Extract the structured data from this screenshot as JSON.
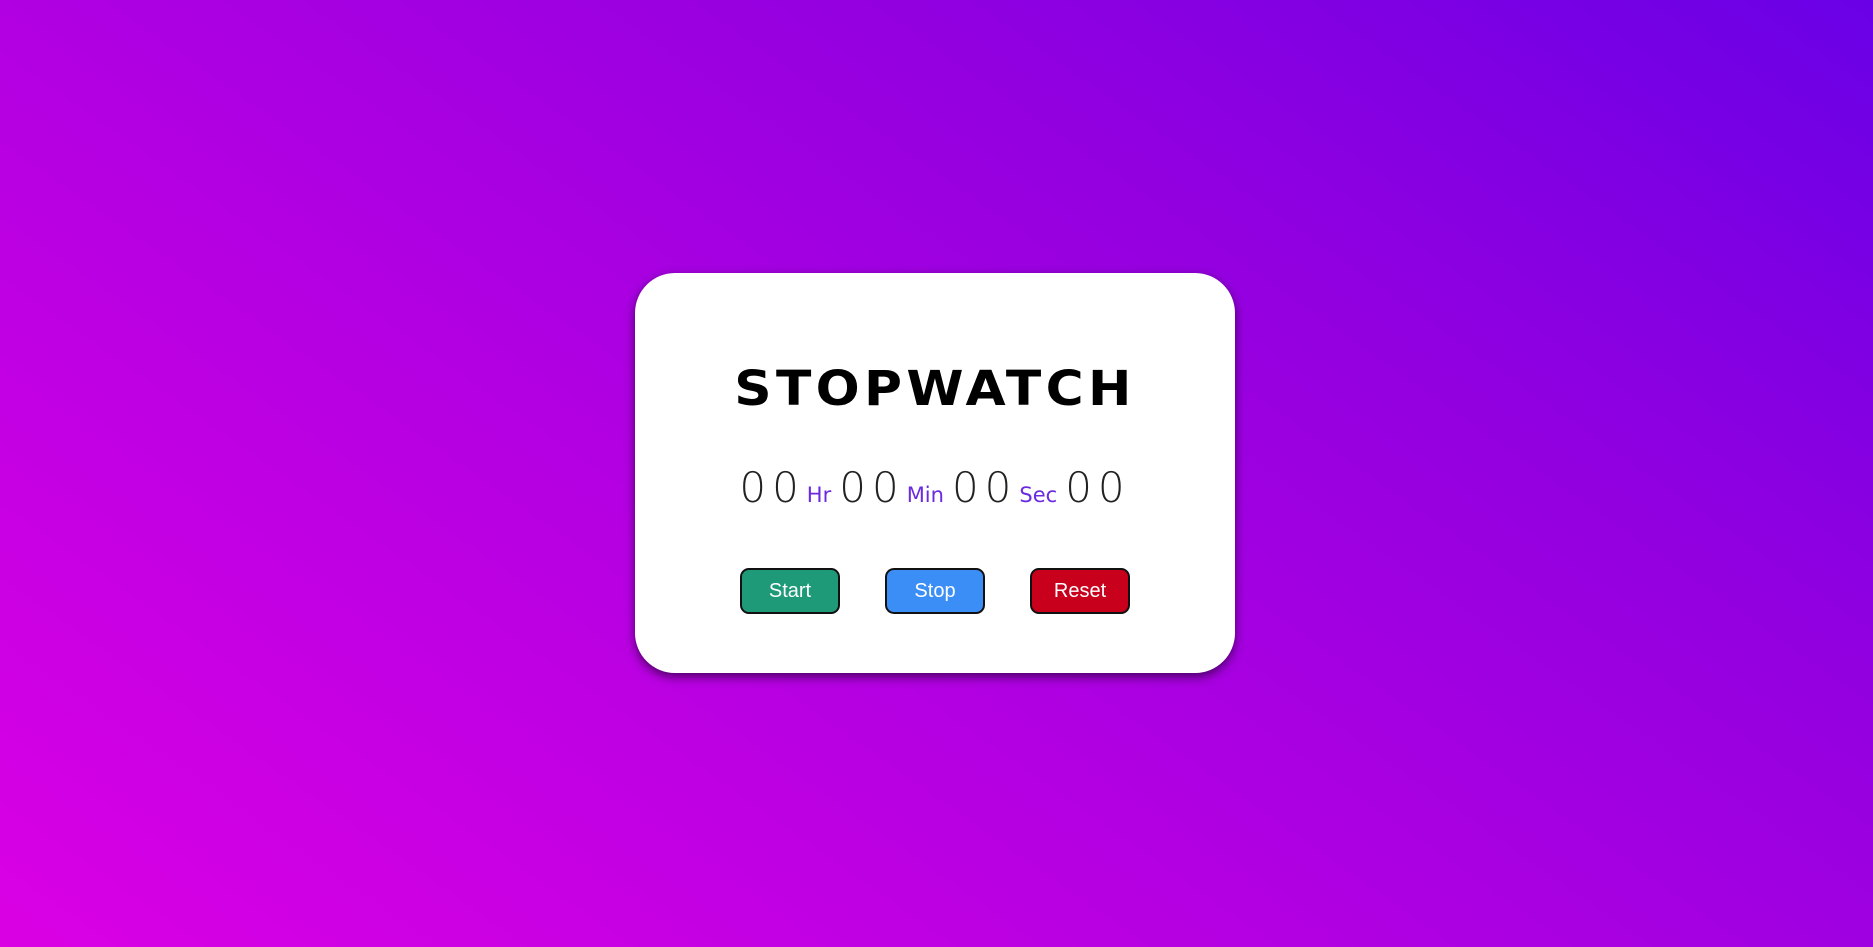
{
  "app": {
    "title": "STOPWATCH"
  },
  "timer": {
    "hours": "00",
    "hours_unit": "Hr",
    "minutes": "00",
    "minutes_unit": "Min",
    "seconds": "00",
    "seconds_unit": "Sec",
    "milliseconds": "00"
  },
  "controls": {
    "start_label": "Start",
    "stop_label": "Stop",
    "reset_label": "Reset"
  },
  "colors": {
    "start": "#1f9a78",
    "stop": "#3a8ef6",
    "reset": "#c8001c",
    "unit_text": "#6a2ae0",
    "background_start": "#db00e4",
    "background_end": "#6a00e6"
  }
}
